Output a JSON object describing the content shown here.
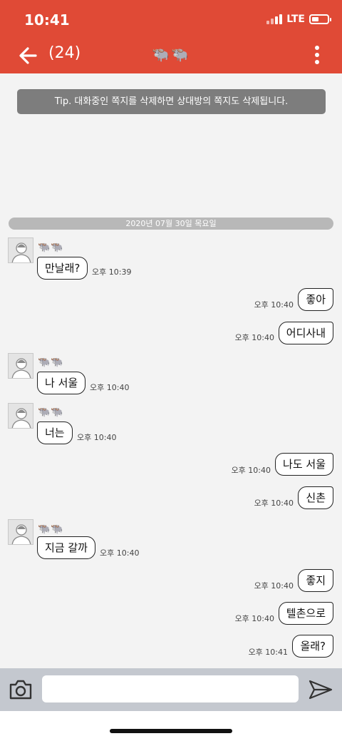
{
  "status_bar": {
    "time": "10:41",
    "network": "LTE"
  },
  "header": {
    "count": "(24)",
    "title": "🐃🐃"
  },
  "tip": "Tip. 대화중인 쪽지를 삭제하면 상대방의 쪽지도 삭제됩니다.",
  "date_separator": "2020년 07월 30일 목요일",
  "messages": [
    {
      "dir": "in",
      "sender": "🐃🐃",
      "text": "만날래?",
      "time": "오후 10:39"
    },
    {
      "dir": "out",
      "text": "좋아",
      "time": "오후 10:40"
    },
    {
      "dir": "out",
      "text": "어디사내",
      "time": "오후 10:40"
    },
    {
      "dir": "in",
      "sender": "🐃🐃",
      "text": "나 서울",
      "time": "오후 10:40"
    },
    {
      "dir": "in",
      "sender": "🐃🐃",
      "text": "너는",
      "time": "오후 10:40"
    },
    {
      "dir": "out",
      "text": "나도 서울",
      "time": "오후 10:40"
    },
    {
      "dir": "out",
      "text": "신촌",
      "time": "오후 10:40"
    },
    {
      "dir": "in",
      "sender": "🐃🐃",
      "text": "지금 갈까",
      "time": "오후 10:40"
    },
    {
      "dir": "out",
      "text": "좋지",
      "time": "오후 10:40"
    },
    {
      "dir": "out",
      "text": "텔촌으로",
      "time": "오후 10:40"
    },
    {
      "dir": "out",
      "text": "올래?",
      "time": "오후 10:41"
    }
  ],
  "composer": {
    "input_value": "",
    "placeholder": ""
  },
  "icons": {
    "back": "arrow-left-icon",
    "more": "vertical-dots-icon",
    "camera": "camera-icon",
    "send": "send-icon"
  },
  "colors": {
    "header_bg": "#e04a36",
    "background": "#f3f3f3",
    "tip_bg": "#7d7d7d",
    "composer_bg": "#c4c8cf"
  }
}
